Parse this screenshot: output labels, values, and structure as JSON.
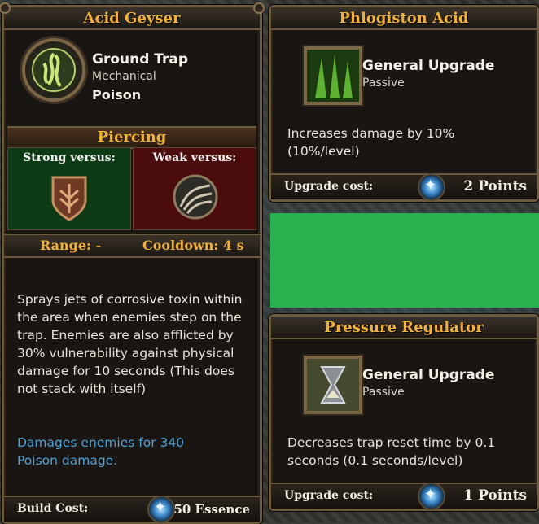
{
  "colors": {
    "accent_title": "#f0b03a",
    "link_blue": "#4fa2d6",
    "green_block": "#2ab14d"
  },
  "left_card": {
    "title": "Acid Geyser",
    "type_name": "Ground Trap",
    "type_sub": "Mechanical",
    "element": "Poison",
    "damage_type": "Piercing",
    "strong_label": "Strong versus:",
    "weak_label": "Weak versus:",
    "range_label": "Range: -",
    "cooldown_label": "Cooldown: 4 s",
    "description": "Sprays jets of corrosive toxin within the area when enemies step on the trap. Enemies are also afflicted by 30% vulnerability against physical damage for 10 seconds (This does not stack with itself)",
    "damage_text": "Damages enemies for 340 Poison damage.",
    "cost_label": "Build Cost:",
    "cost_value": "50 Essence",
    "icons": {
      "trap": "acid-geyser-icon",
      "strong": "armored-shield-icon",
      "weak": "clawed-creature-icon",
      "cost": "essence-crystal-icon"
    }
  },
  "upgrade_cards": [
    {
      "title": "Phlogiston Acid",
      "kind": "General Upgrade",
      "sub": "Passive",
      "description": "Increases damage by 10% (10%/level)",
      "cost_label": "Upgrade cost:",
      "cost_value": "2 Points",
      "icon": "green-acid-upgrade-icon"
    },
    {
      "title": "Pressure Regulator",
      "kind": "General Upgrade",
      "sub": "Passive",
      "description": "Decreases trap reset time by 0.1 seconds (0.1 seconds/level)",
      "cost_label": "Upgrade cost:",
      "cost_value": "1 Points",
      "icon": "hourglass-upgrade-icon"
    }
  ]
}
